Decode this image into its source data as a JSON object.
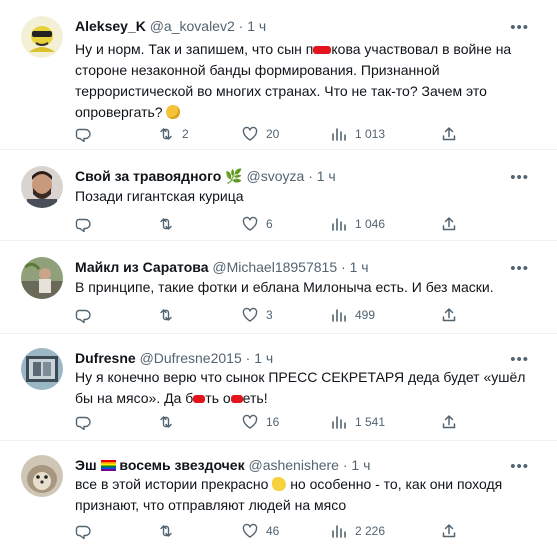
{
  "tweets": [
    {
      "name": "Aleksey_K",
      "handle": "@a_kovalev2",
      "time": "· 1 ч",
      "text_parts": [
        "Ну и норм. Так и запишем, что сын п",
        "кова участвовал в войне на стороне незаконной банды  формирования. Признанной террористической во многих странах. Что не так-то? Зачем это опровергать?"
      ],
      "emoji": "thinking-face",
      "replies": "",
      "retweets": "2",
      "likes": "20",
      "views": "1 013"
    },
    {
      "name": "Свой за травоядного",
      "handle": "@svoyza",
      "time": "· 1 ч",
      "text": "Позади гигантская курица",
      "replies": "",
      "retweets": "",
      "likes": "6",
      "views": "1 046"
    },
    {
      "name": "Майкл из Саратова",
      "handle": "@Michael18957815",
      "time": "· 1 ч",
      "text": "В принципе, такие фотки и еблана Милоныча есть. И без маски.",
      "replies": "",
      "retweets": "",
      "likes": "3",
      "views": "499"
    },
    {
      "name": "Dufresne",
      "handle": "@Dufresne2015",
      "time": "· 1 ч",
      "text_parts": [
        "Ну я конечно верю что сынок ПРЕСС СЕКРЕТАРЯ деда будет «ушёл бы на мясо». Да б",
        "ть о",
        "еть!"
      ],
      "replies": "",
      "retweets": "",
      "likes": "16",
      "views": "1 541"
    },
    {
      "name": "Эш",
      "name2": "восемь звездочек",
      "handle": "@ashenishere",
      "time": "· 1 ч",
      "text_parts": [
        "все в этой истории прекрасно",
        "но особенно - то, как они походя признают, что отправляют людей на мясо"
      ],
      "emoji": "clapping-hands",
      "replies": "",
      "retweets": "",
      "likes": "46",
      "views": "2 226"
    }
  ],
  "icons": {
    "reply": "reply-icon",
    "retweet": "retweet-icon",
    "like": "heart-icon",
    "views": "views-icon",
    "share": "share-icon",
    "more": "more-icon"
  },
  "colors": {
    "muted": "#536471",
    "text": "#0f1419",
    "redaction": "#e4141c"
  }
}
